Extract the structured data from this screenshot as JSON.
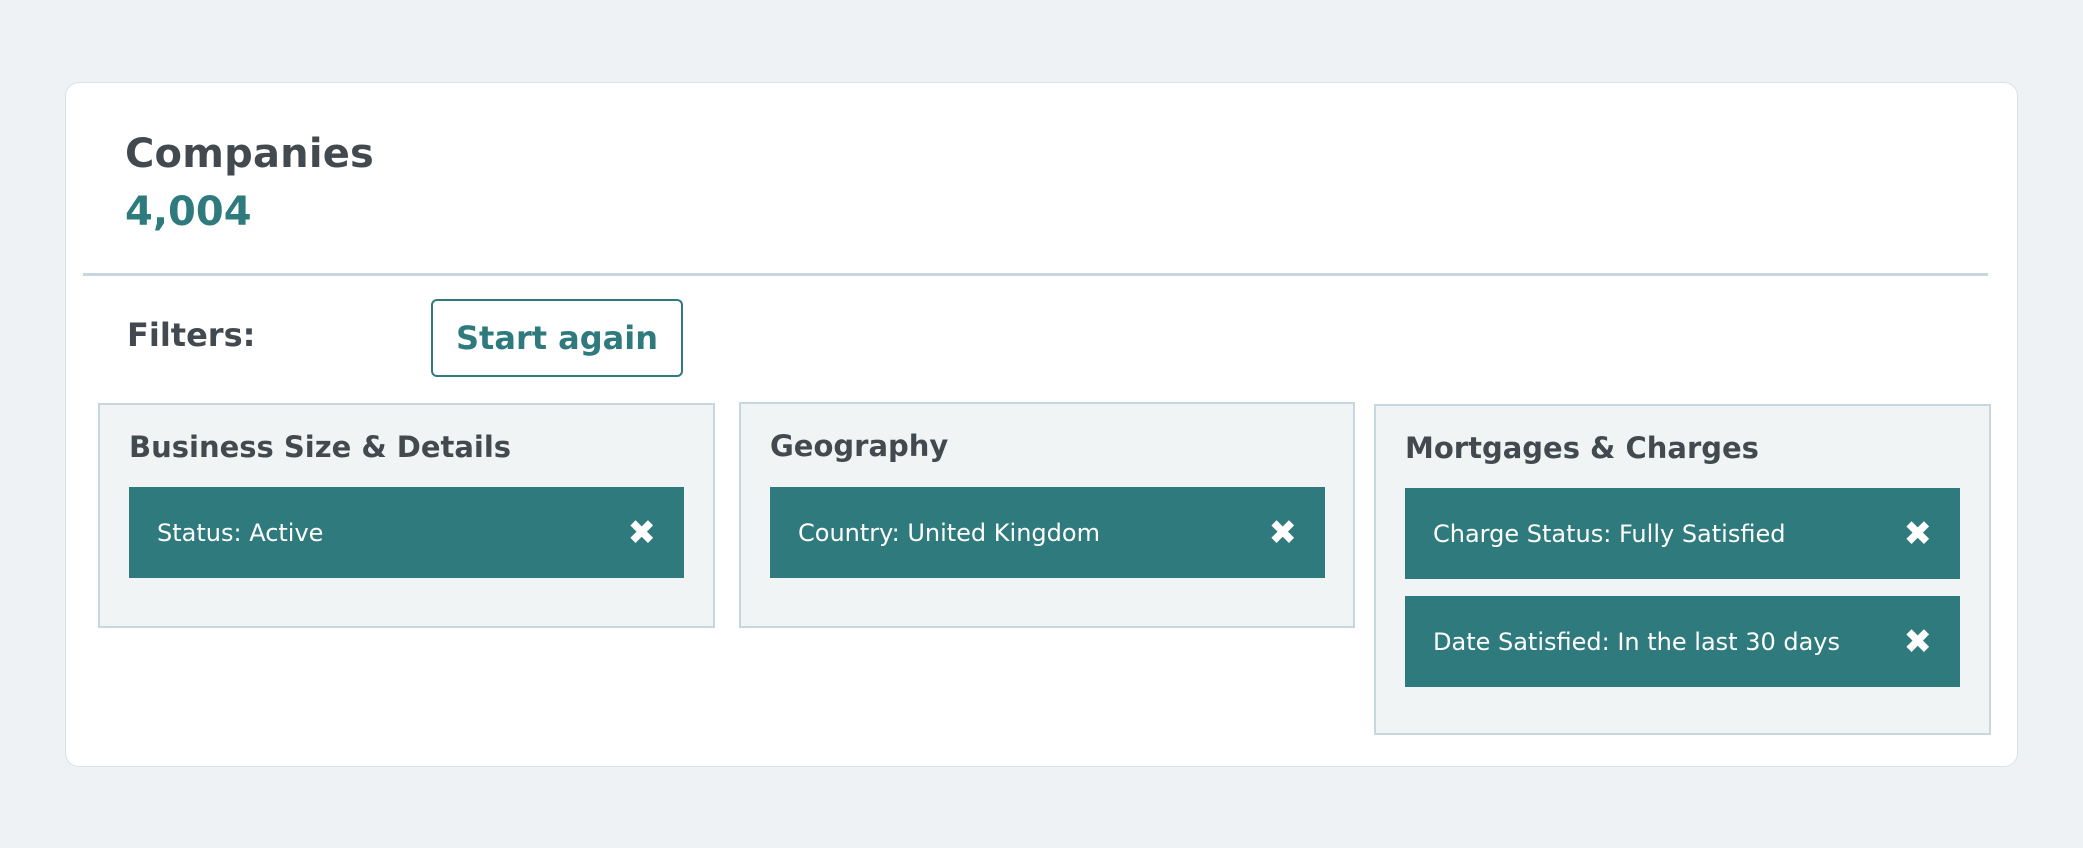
{
  "header": {
    "title": "Companies",
    "count": "4,004"
  },
  "filters": {
    "label": "Filters:",
    "start_again_label": "Start again"
  },
  "groups": [
    {
      "title": "Business Size & Details",
      "chips": [
        {
          "label": "Status: Active",
          "remove_icon": "✖"
        }
      ]
    },
    {
      "title": "Geography",
      "chips": [
        {
          "label": "Country: United Kingdom",
          "remove_icon": "✖"
        }
      ]
    },
    {
      "title": "Mortgages & Charges",
      "chips": [
        {
          "label": "Charge Status: Fully Satisfied",
          "remove_icon": "✖"
        },
        {
          "label": "Date Satisfied: In the last 30 days",
          "remove_icon": "✖"
        }
      ]
    }
  ],
  "colors": {
    "accent": "#2e7a7d",
    "text": "#434a4f",
    "page_background": "#eef2f4",
    "group_background": "#f0f4f5"
  },
  "icons": {
    "remove": "close-icon"
  }
}
